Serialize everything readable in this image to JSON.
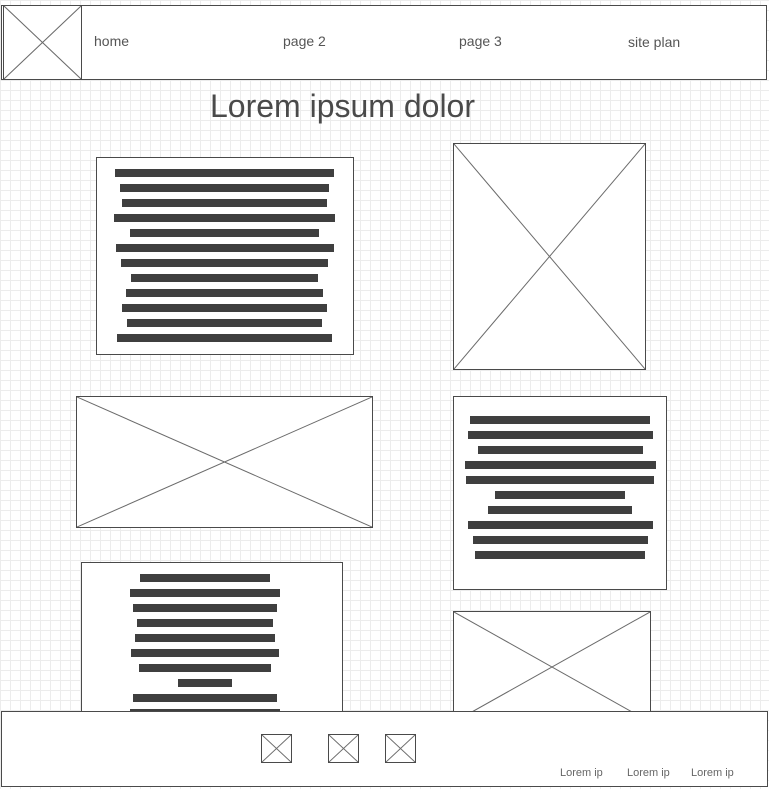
{
  "header": {
    "nav": [
      "home",
      "page 2",
      "page 3",
      "site plan"
    ]
  },
  "main": {
    "title": "Lorem ipsum dolor"
  },
  "footer": {
    "links": [
      "Lorem ip",
      "Lorem ip",
      "Lorem ip"
    ]
  }
}
